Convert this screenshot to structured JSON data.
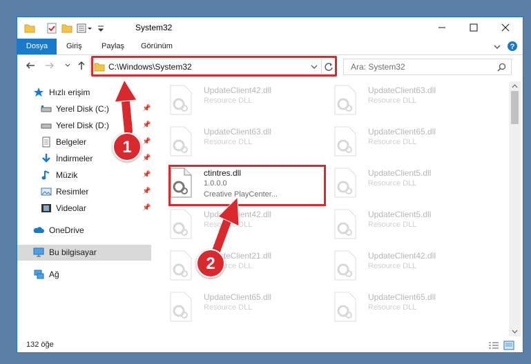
{
  "window": {
    "title": "System32"
  },
  "ribbon": {
    "tabs": [
      "Dosya",
      "Giriş",
      "Paylaş",
      "Görünüm"
    ]
  },
  "address": {
    "path": "C:\\Windows\\System32"
  },
  "search": {
    "placeholder": "Ara: System32"
  },
  "sidebar": {
    "items": [
      {
        "label": "Hızlı erişim",
        "icon": "star-icon",
        "pinned": false
      },
      {
        "label": "Yerel Disk (C:)",
        "icon": "drive-icon",
        "pinned": true
      },
      {
        "label": "Yerel Disk (D:)",
        "icon": "drive-icon",
        "pinned": true
      },
      {
        "label": "Belgeler",
        "icon": "document-icon",
        "pinned": true
      },
      {
        "label": "İndirmeler",
        "icon": "download-icon",
        "pinned": true
      },
      {
        "label": "Müzik",
        "icon": "music-icon",
        "pinned": true
      },
      {
        "label": "Resimler",
        "icon": "pictures-icon",
        "pinned": true
      },
      {
        "label": "Videolar",
        "icon": "video-icon",
        "pinned": true
      },
      {
        "label": "OneDrive",
        "icon": "cloud-icon",
        "pinned": false
      },
      {
        "label": "Bu bilgisayar",
        "icon": "computer-icon",
        "pinned": false,
        "selected": true
      },
      {
        "label": "Ağ",
        "icon": "network-icon",
        "pinned": false
      }
    ]
  },
  "files": [
    {
      "name": "UpdateClient42.dll",
      "desc": "Resource DLL",
      "col": 0
    },
    {
      "name": "UpdateClient63.dll",
      "desc": "Resource DLL",
      "col": 1
    },
    {
      "name": "UpdateClient63.dll",
      "desc": "Resource DLL",
      "col": 0
    },
    {
      "name": "UpdateClient65.dll",
      "desc": "Resource DLL",
      "col": 1
    },
    {
      "name": "ctintres.dll",
      "version": "1.0.0.0",
      "desc": "Creative PlayCenter...",
      "col": 0,
      "highlighted": true
    },
    {
      "name": "UpdateClient5.dll",
      "desc": "Resource DLL",
      "col": 1
    },
    {
      "name": "UpdateClient42.dll",
      "desc": "Resource DLL",
      "col": 0
    },
    {
      "name": "UpdateClient5.dll",
      "desc": "Resource DLL",
      "col": 1
    },
    {
      "name": "UpdateClient21.dll",
      "desc": "Resource DLL",
      "col": 0
    },
    {
      "name": "UpdateClient42.dll",
      "desc": "Resource DLL",
      "col": 1
    },
    {
      "name": "UpdateClient65.dll",
      "desc": "Resource DLL",
      "col": 0
    },
    {
      "name": "UpdateClient65.dll",
      "desc": "Resource DLL",
      "col": 1
    }
  ],
  "status": {
    "count": "132 öğe"
  },
  "annotations": {
    "step1": "1",
    "step2": "2"
  },
  "colors": {
    "accent": "#1979ca",
    "highlight": "#d9282e",
    "selected": "#d9d9d9"
  }
}
